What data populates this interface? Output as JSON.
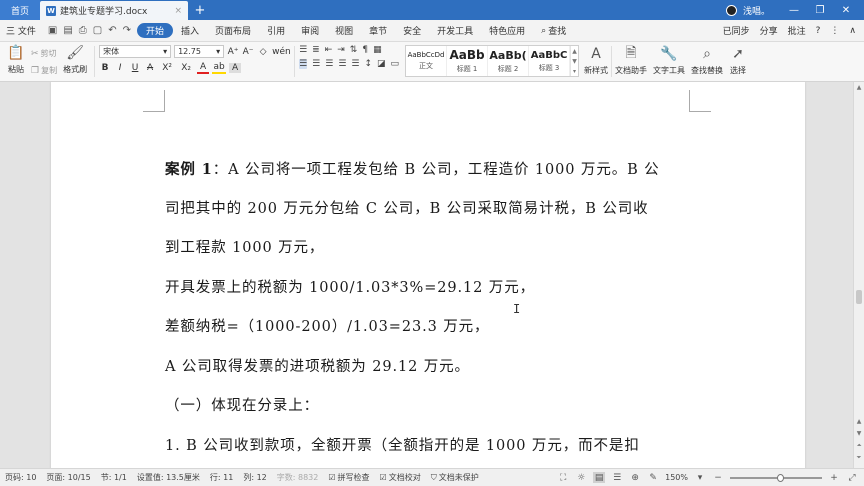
{
  "tabstrip": {
    "home_label": "首页",
    "doc_title": "建筑业专题学习.docx",
    "doc_close": "×",
    "add_tab": "+",
    "user_name": "浅唱。",
    "min": "—",
    "restore": "❐",
    "close": "✕"
  },
  "menubar": {
    "file_label": "三 文件",
    "items": [
      "开始",
      "插入",
      "页面布局",
      "引用",
      "审阅",
      "视图",
      "章节",
      "安全",
      "开发工具",
      "特色应用"
    ],
    "search_label": "查找",
    "sync_label": "已同步",
    "share_label": "分享",
    "annotate_label": "批注",
    "help": "?",
    "more": "⋮",
    "collapse": "∧"
  },
  "ribbon": {
    "paste_label": "粘贴",
    "cut_label": "剪切",
    "copy_label": "复制",
    "format_painter_label": "格式刷",
    "font_name": "宋体",
    "font_size": "12.75",
    "font_grow": "A⁺",
    "font_shrink": "A⁻",
    "clear_format": "◇",
    "phonetic": "wén",
    "bold": "B",
    "italic": "I",
    "underline": "U",
    "strike": "A",
    "superscript": "X²",
    "subscript": "X₂",
    "font_color": "A",
    "highlight": "ab",
    "char_shading": "A",
    "style_normal_sample": "AaBbCcDd",
    "style_normal_name": "正文",
    "style_h1_sample": "AaBb",
    "style_h1_name": "标题 1",
    "style_h2_sample": "AaBb(",
    "style_h2_name": "标题 2",
    "style_h3_sample": "AaBbC",
    "style_h3_name": "标题 3",
    "new_style_label": "新样式",
    "doc_helper_label": "文档助手",
    "text_tools_label": "文字工具",
    "find_replace_label": "查找替换",
    "select_label": "选择"
  },
  "document": {
    "p1_bold": "案例 1",
    "p1_rest": "：A 公司将一项工程发包给 B 公司，工程造价 1000 万元。B 公",
    "p2": "司把其中的 200 万元分包给 C 公司，B 公司采取简易计税，B 公司收",
    "p3": "到工程款 1000 万元，",
    "p4": "开具发票上的税额为 1000/1.03*3%=29.12 万元，",
    "p5": "差额纳税=（1000-200）/1.03=23.3 万元，",
    "p6": "A 公司取得发票的进项税额为 29.12 万元。",
    "p7": "（一）体现在分录上：",
    "p8": "1. B 公司收到款项，全额开票（全额指开的是 1000 万元，而不是扣"
  },
  "status": {
    "page_code": "页码: 10",
    "pages": "页面: 10/15",
    "section": "节: 1/1",
    "setting": "设置值: 13.5厘米",
    "row": "行: 11",
    "col": "列: 12",
    "word_count": "字数: 8832",
    "spellcheck": "拼写检查",
    "doc_compare": "文档校对",
    "unprotected": "文档未保护",
    "zoom": "150%",
    "zoom_level": 0.55
  }
}
